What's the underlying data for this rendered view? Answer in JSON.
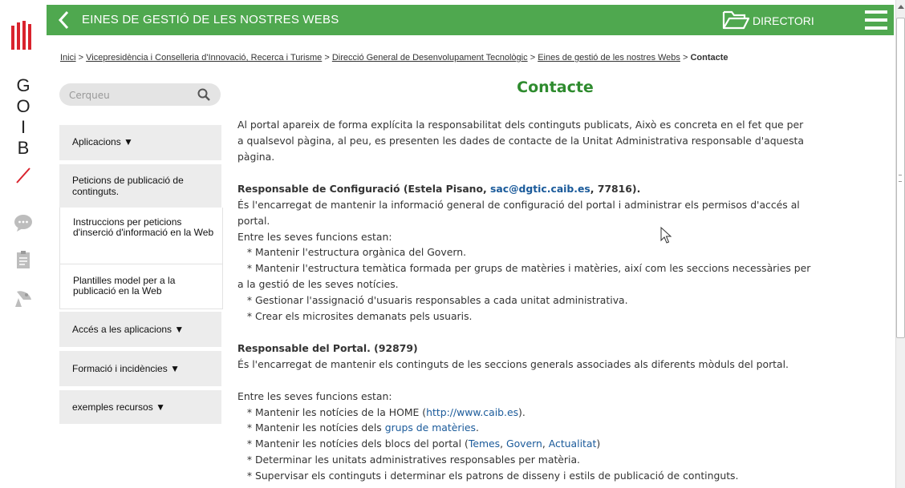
{
  "rail": {
    "letters": [
      "G",
      "O",
      "I",
      "B"
    ],
    "icons": [
      "chat-icon",
      "clipboard-icon",
      "satellite-dish-icon"
    ]
  },
  "header": {
    "title": "EINES DE GESTIÓ DE LES NOSTRES WEBS",
    "directory_label": "DIRECTORI",
    "color": "#4fa84f"
  },
  "breadcrumb": {
    "items": [
      "Inici",
      "Vicepresidència i Conselleria d'Innovació, Recerca i Turisme",
      "Direcció General de Desenvolupament Tecnològic",
      "Eines de gestió de les nostres Webs"
    ],
    "separator": ">",
    "current": "Contacte"
  },
  "search": {
    "placeholder": "Cerqueu"
  },
  "sidebar": {
    "sections": [
      {
        "label": "Aplicacions"
      },
      {
        "label": "Peticions de publicació de continguts."
      },
      {
        "label": "Accés a les aplicacions"
      },
      {
        "label": "Formació i incidències"
      },
      {
        "label": "exemples recursos"
      }
    ],
    "subitems": [
      {
        "label": "Instruccions per peticions d'inserció d'informació en la Web"
      },
      {
        "label": "Plantilles model per a la publicació en la Web"
      }
    ]
  },
  "main": {
    "title": "Contacte",
    "intro": [
      "Al portal apareix de forma explícita la responsabilitat dels continguts publicats, Això es concreta en el fet que per",
      "a qualsevol pàgina, al peu, es presenten les dades de contacte de la Unitat Administrativa responsable d'aquesta",
      "pàgina."
    ],
    "config": {
      "heading_pre": "Responsable de Configuració (Estela Pisano, ",
      "email": "sac@dgtic.caib.es",
      "heading_post": ", 77816).",
      "lines": [
        "És l'encarregat de mantenir la informació general de configuració del portal i administrar els permisos d'accés al",
        "portal.",
        "Entre les seves funcions estan:",
        "   * Mantenir l'estructura orgànica del Govern.",
        "   * Mantenir l'estructura temàtica formada per grups de matèries i matèries, així com les seccions necessàries per",
        "a la gestió de les seves notícies.",
        "   * Gestionar l'assignació d'usuaris responsables a cada unitat administrativa.",
        "   * Crear els microsites demanats pels usuaris."
      ]
    },
    "portal": {
      "heading": "Responsable del Portal. (92879)",
      "desc": "És l'encarregat de mantenir els continguts de les seccions generals associades als diferents mòduls del portal.",
      "functions_intro": "Entre les seves funcions estan:",
      "f1_pre": "   * Mantenir les notícies de la HOME (",
      "f1_link": "http://www.caib.es",
      "f1_post": ").",
      "f2_pre": "   * Mantenir les notícies dels ",
      "f2_link": "grups de matèries",
      "f2_post": ".",
      "f3_pre": "   * Mantenir les notícies dels blocs del portal (",
      "f3_links": [
        "Temes",
        "Govern",
        "Actualitat"
      ],
      "f3_post": ")",
      "f4": "   * Determinar les unitats administratives responsables per matèria.",
      "f5": "   * Supervisar els continguts i determinar els patrons de disseny i estils de publicació de continguts."
    }
  }
}
